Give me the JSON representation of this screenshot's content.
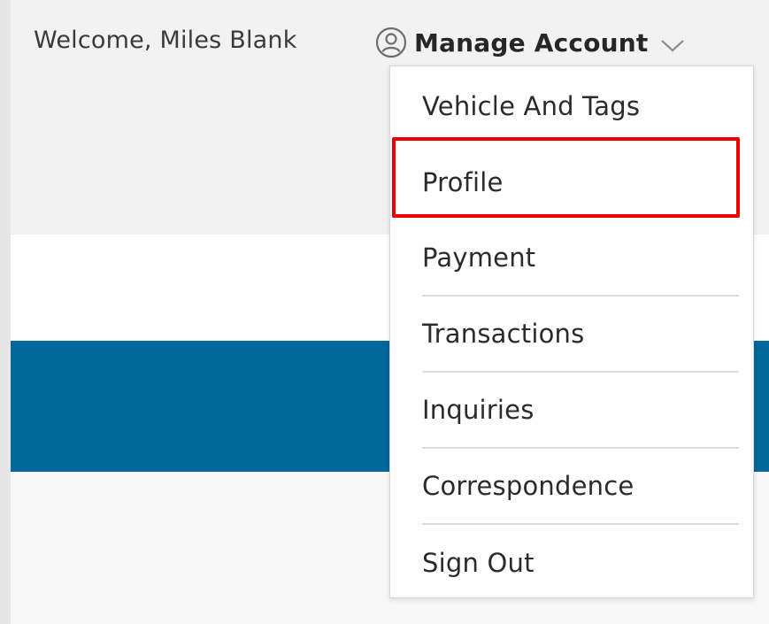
{
  "header": {
    "welcome_text": "Welcome, Miles Blank",
    "manage_account_label": "Manage Account"
  },
  "menu": {
    "items": [
      {
        "label": "Vehicle And Tags"
      },
      {
        "label": "Profile"
      },
      {
        "label": "Payment"
      },
      {
        "label": "Transactions"
      },
      {
        "label": "Inquiries"
      },
      {
        "label": "Correspondence"
      },
      {
        "label": "Sign Out"
      }
    ]
  },
  "colors": {
    "brand_blue": "#02679a",
    "highlight_red": "#ee0000"
  },
  "icons": {
    "account": "user-circle-icon",
    "dropdown": "chevron-down-icon"
  }
}
